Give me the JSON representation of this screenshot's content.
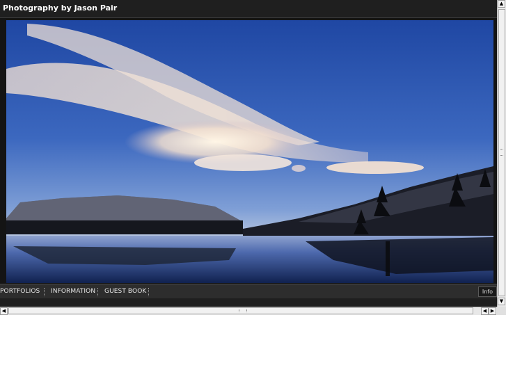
{
  "header": {
    "title": "Photography by Jason Pair"
  },
  "nav": {
    "items": [
      {
        "label": "PORTFOLIOS"
      },
      {
        "label": "INFORMATION"
      },
      {
        "label": "GUEST BOOK"
      }
    ],
    "info_label": "Info"
  },
  "photo": {
    "subject": "lenticular clouds over mountain lake at dusk"
  },
  "scrollbar": {
    "up_arrow": "▲",
    "down_arrow": "▼",
    "left_arrow": "◀",
    "right_arrow": "▶"
  },
  "colors": {
    "frame_bg": "#141414",
    "titlebar_bg": "#1f1f1f",
    "navbar_bg": "#2d2d2d",
    "sky_top": "#2a4fa8",
    "sky_horizon": "#9fb7da"
  }
}
